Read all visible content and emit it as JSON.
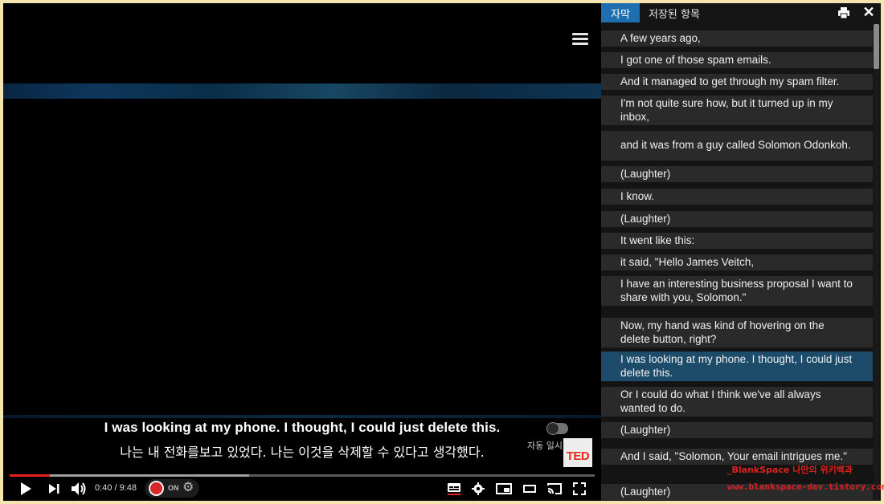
{
  "player": {
    "subtitle_en": "I was looking at my phone. I thought, I could just delete this.",
    "subtitle_ko": "나는 내 전화를보고 있었다. 나는 이것을 삭제할 수 있다고 생각했다.",
    "autoplay_label": "자동 일시 중지",
    "ted_logo": "TED",
    "current_time": "0:40",
    "duration": "9:48",
    "time_separator": " / ",
    "progress_played_fraction": 0.068,
    "progress_buffered_fraction": 0.41,
    "extension_toggle": "ON",
    "icons": [
      "menu-icon",
      "play-icon",
      "next-icon",
      "volume-icon",
      "settings-icon",
      "subtitles-icon",
      "miniplayer-icon",
      "theater-icon",
      "cast-icon",
      "fullscreen-icon"
    ],
    "colors": {
      "progress": "#e62117",
      "subtitle_underline": "#e62117"
    }
  },
  "panel": {
    "tabs": [
      {
        "label": "자막",
        "active": true
      },
      {
        "label": "저장된 항목",
        "active": false
      }
    ],
    "icons": [
      "print-icon",
      "close-icon"
    ],
    "active_color": "#1f6fb0",
    "entries": [
      {
        "text": "A few years ago,"
      },
      {
        "text": "I got one of those spam emails."
      },
      {
        "text": "And it managed to get through my spam filter."
      },
      {
        "text": "I'm not quite sure how, but it turned up in my inbox,"
      },
      {
        "text": "and it was from a guy called Solomon Odonkoh."
      },
      {
        "text": "(Laughter)"
      },
      {
        "text": "I know."
      },
      {
        "text": "(Laughter)"
      },
      {
        "text": "It went like this:"
      },
      {
        "text": "it said, \"Hello James Veitch,"
      },
      {
        "text": "I have an interesting business proposal I want to share with you, Solomon.\""
      },
      {
        "text": "Now, my hand was kind of hovering on the delete button, right?"
      },
      {
        "text": "I was looking at my phone. I thought, I could just delete this.",
        "active": true
      },
      {
        "text": "Or I could do what I think we've all always wanted to do."
      },
      {
        "text": "(Laughter)"
      },
      {
        "text": "And I said, \"Solomon, Your email intrigues me.\""
      },
      {
        "text": "(Laughter)"
      }
    ]
  },
  "watermark": {
    "line1": "_BlankSpace 나만의 위키백과",
    "line2": "www.blankspace-dev.tistory.com"
  }
}
